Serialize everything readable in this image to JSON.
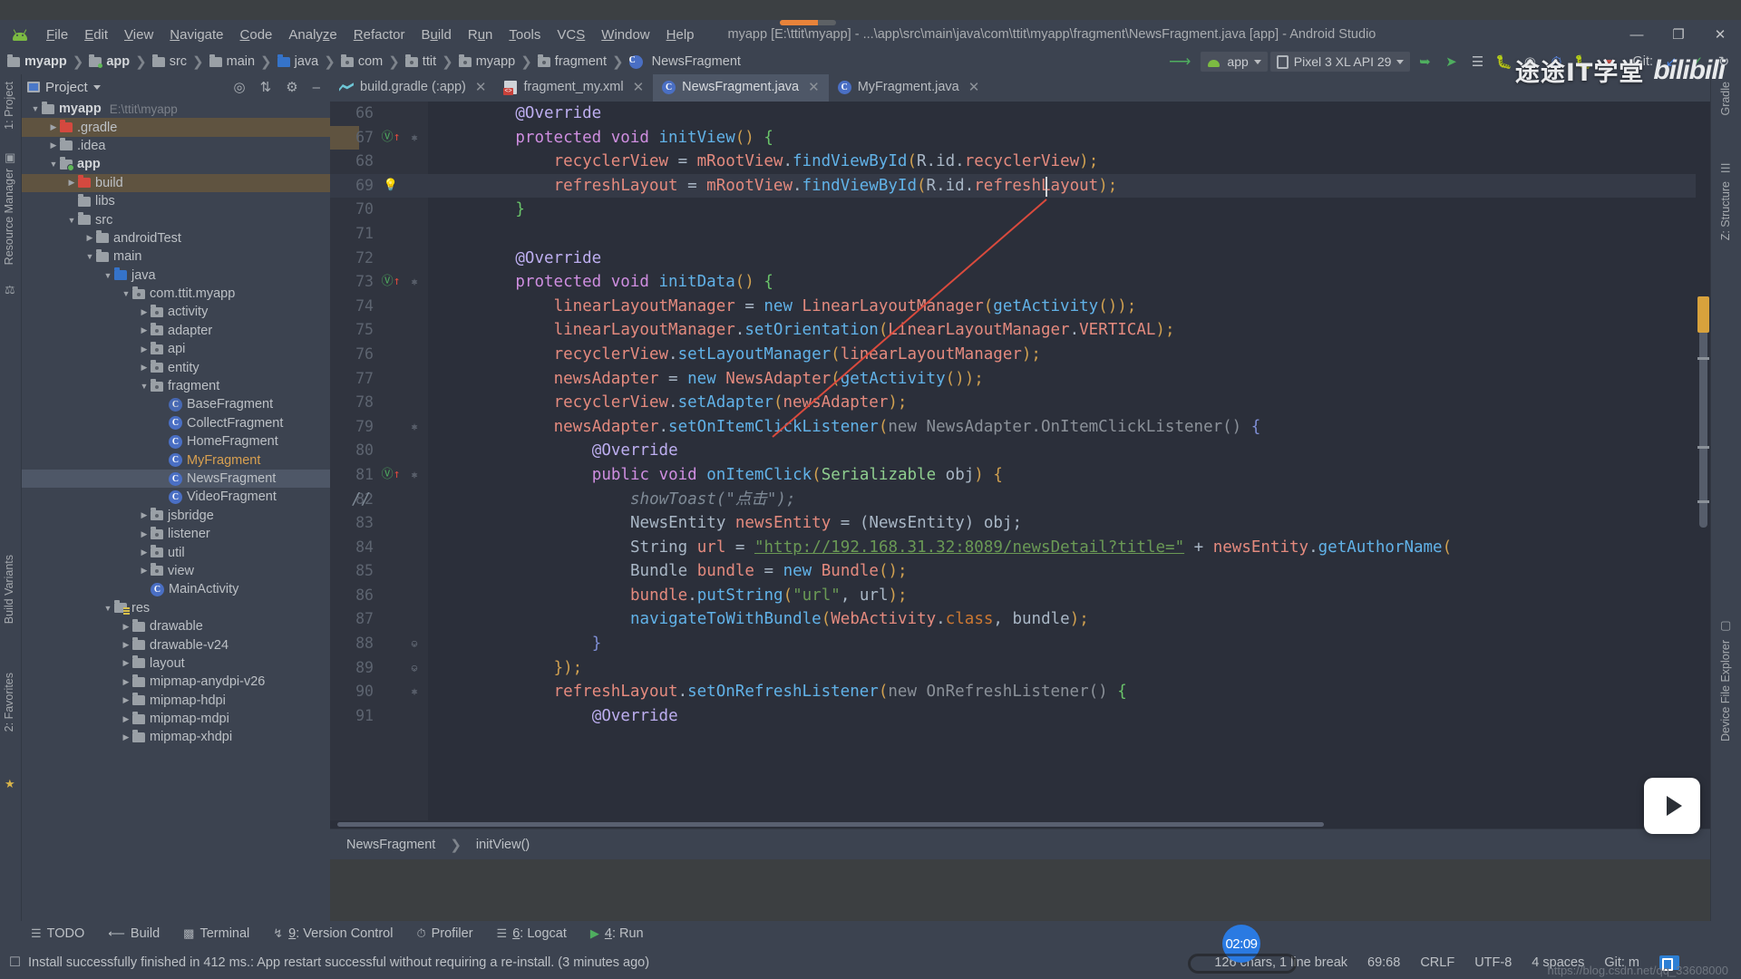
{
  "window": {
    "title": "myapp [E:\\ttit\\myapp] - ...\\app\\src\\main\\java\\com\\ttit\\myapp\\fragment\\NewsFragment.java [app] - Android Studio",
    "minimize": "—",
    "maximize": "❐",
    "close": "✕"
  },
  "menu": [
    "File",
    "Edit",
    "View",
    "Navigate",
    "Code",
    "Analyze",
    "Refactor",
    "Build",
    "Run",
    "Tools",
    "VCS",
    "Window",
    "Help"
  ],
  "breadcrumb": [
    {
      "label": "myapp",
      "icon": "folder-icon",
      "bold": true
    },
    {
      "label": "app",
      "icon": "module-folder-icon",
      "bold": true
    },
    {
      "label": "src",
      "icon": "folder-icon",
      "bold": false
    },
    {
      "label": "main",
      "icon": "folder-icon",
      "bold": false
    },
    {
      "label": "java",
      "icon": "source-folder-icon",
      "bold": false
    },
    {
      "label": "com",
      "icon": "package-icon",
      "bold": false
    },
    {
      "label": "ttit",
      "icon": "package-icon",
      "bold": false
    },
    {
      "label": "myapp",
      "icon": "package-icon",
      "bold": false
    },
    {
      "label": "fragment",
      "icon": "package-icon",
      "bold": false
    },
    {
      "label": "NewsFragment",
      "icon": "class-icon",
      "bold": false
    }
  ],
  "toolbar": {
    "run_config": "app",
    "device": "Pixel 3 XL API 29",
    "git_label": "Git:"
  },
  "watermark": {
    "chinese": "途途IT学堂",
    "brand": "bilibili"
  },
  "project_panel": {
    "title": "Project",
    "tree": [
      {
        "depth": 0,
        "tw": "▼",
        "icon": "folder",
        "label": "myapp",
        "bold": true,
        "path": "E:\\ttit\\myapp"
      },
      {
        "depth": 1,
        "tw": "▶",
        "icon": "folder-red",
        "label": ".gradle",
        "highlight": true
      },
      {
        "depth": 1,
        "tw": "▶",
        "icon": "folder",
        "label": ".idea"
      },
      {
        "depth": 1,
        "tw": "▼",
        "icon": "folder-module",
        "label": "app",
        "bold": true
      },
      {
        "depth": 2,
        "tw": "▶",
        "icon": "folder-red",
        "label": "build",
        "highlight": true
      },
      {
        "depth": 2,
        "tw": "",
        "icon": "folder",
        "label": "libs"
      },
      {
        "depth": 2,
        "tw": "▼",
        "icon": "folder",
        "label": "src"
      },
      {
        "depth": 3,
        "tw": "▶",
        "icon": "folder",
        "label": "androidTest"
      },
      {
        "depth": 3,
        "tw": "▼",
        "icon": "folder",
        "label": "main"
      },
      {
        "depth": 4,
        "tw": "▼",
        "icon": "folder-blue",
        "label": "java"
      },
      {
        "depth": 5,
        "tw": "▼",
        "icon": "package",
        "label": "com.ttit.myapp"
      },
      {
        "depth": 6,
        "tw": "▶",
        "icon": "package",
        "label": "activity"
      },
      {
        "depth": 6,
        "tw": "▶",
        "icon": "package",
        "label": "adapter"
      },
      {
        "depth": 6,
        "tw": "▶",
        "icon": "package",
        "label": "api"
      },
      {
        "depth": 6,
        "tw": "▶",
        "icon": "package",
        "label": "entity"
      },
      {
        "depth": 6,
        "tw": "▼",
        "icon": "package",
        "label": "fragment"
      },
      {
        "depth": 7,
        "tw": "",
        "icon": "class-abstract",
        "label": "BaseFragment"
      },
      {
        "depth": 7,
        "tw": "",
        "icon": "class",
        "label": "CollectFragment"
      },
      {
        "depth": 7,
        "tw": "",
        "icon": "class",
        "label": "HomeFragment"
      },
      {
        "depth": 7,
        "tw": "",
        "icon": "class",
        "label": "MyFragment",
        "orange": true
      },
      {
        "depth": 7,
        "tw": "",
        "icon": "class",
        "label": "NewsFragment",
        "selected": true
      },
      {
        "depth": 7,
        "tw": "",
        "icon": "class",
        "label": "VideoFragment"
      },
      {
        "depth": 6,
        "tw": "▶",
        "icon": "package",
        "label": "jsbridge"
      },
      {
        "depth": 6,
        "tw": "▶",
        "icon": "package",
        "label": "listener"
      },
      {
        "depth": 6,
        "tw": "▶",
        "icon": "package",
        "label": "util"
      },
      {
        "depth": 6,
        "tw": "▶",
        "icon": "package",
        "label": "view"
      },
      {
        "depth": 6,
        "tw": "",
        "icon": "class",
        "label": "MainActivity"
      },
      {
        "depth": 4,
        "tw": "▼",
        "icon": "folder-res",
        "label": "res"
      },
      {
        "depth": 5,
        "tw": "▶",
        "icon": "folder",
        "label": "drawable"
      },
      {
        "depth": 5,
        "tw": "▶",
        "icon": "folder",
        "label": "drawable-v24"
      },
      {
        "depth": 5,
        "tw": "▶",
        "icon": "folder",
        "label": "layout"
      },
      {
        "depth": 5,
        "tw": "▶",
        "icon": "folder",
        "label": "mipmap-anydpi-v26"
      },
      {
        "depth": 5,
        "tw": "▶",
        "icon": "folder",
        "label": "mipmap-hdpi"
      },
      {
        "depth": 5,
        "tw": "▶",
        "icon": "folder",
        "label": "mipmap-mdpi"
      },
      {
        "depth": 5,
        "tw": "▶",
        "icon": "folder",
        "label": "mipmap-xhdpi"
      }
    ]
  },
  "left_strip": [
    "1: Project",
    "Resource Manager",
    "Build Variants",
    "2: Favorites"
  ],
  "right_strip": [
    "Gradle",
    "Z: Structure",
    "Device File Explorer"
  ],
  "editor": {
    "tabs": [
      {
        "label": "build.gradle (:app)",
        "icon": "gradle-icon",
        "active": false
      },
      {
        "label": "fragment_my.xml",
        "icon": "xml-icon",
        "active": false
      },
      {
        "label": "NewsFragment.java",
        "icon": "class-icon",
        "active": true
      },
      {
        "label": "MyFragment.java",
        "icon": "class-icon",
        "active": false
      }
    ],
    "breadcrumb_bottom": [
      "NewsFragment",
      "initView()"
    ],
    "first_line": 66,
    "lines": [
      {
        "n": 66,
        "indent": 8,
        "tokens": [
          {
            "t": "@Override",
            "c": "anno"
          }
        ]
      },
      {
        "n": 67,
        "indent": 8,
        "mark": "override",
        "fold": "minus",
        "tokens": [
          {
            "t": "protected ",
            "c": "kw2"
          },
          {
            "t": "void ",
            "c": "kw2"
          },
          {
            "t": "initView",
            "c": "mth"
          },
          {
            "t": "()",
            "c": "par"
          },
          {
            "t": " {",
            "c": "brace-g"
          }
        ]
      },
      {
        "n": 68,
        "indent": 12,
        "tokens": [
          {
            "t": "recyclerView",
            "c": "fld"
          },
          {
            "t": " = ",
            "c": "pnc"
          },
          {
            "t": "mRootView",
            "c": "fld"
          },
          {
            "t": ".",
            "c": "pnc"
          },
          {
            "t": "findViewById",
            "c": "mth"
          },
          {
            "t": "(",
            "c": "par"
          },
          {
            "t": "R",
            "c": "typ"
          },
          {
            "t": ".",
            "c": "pnc"
          },
          {
            "t": "id",
            "c": "typ"
          },
          {
            "t": ".",
            "c": "pnc"
          },
          {
            "t": "recyclerView",
            "c": "fld"
          },
          {
            "t": ");",
            "c": "par"
          }
        ]
      },
      {
        "n": 69,
        "indent": 12,
        "mark": "bulb",
        "current": true,
        "tokens": [
          {
            "t": "refreshLayout",
            "c": "fld"
          },
          {
            "t": " = ",
            "c": "pnc"
          },
          {
            "t": "mRootView",
            "c": "fld"
          },
          {
            "t": ".",
            "c": "pnc"
          },
          {
            "t": "findViewById",
            "c": "mth"
          },
          {
            "t": "(",
            "c": "par"
          },
          {
            "t": "R",
            "c": "typ"
          },
          {
            "t": ".",
            "c": "pnc"
          },
          {
            "t": "id",
            "c": "typ"
          },
          {
            "t": ".",
            "c": "pnc"
          },
          {
            "t": "refreshLayout",
            "c": "fld"
          },
          {
            "t": ");",
            "c": "par"
          }
        ]
      },
      {
        "n": 70,
        "indent": 8,
        "tokens": [
          {
            "t": "}",
            "c": "brace-g"
          }
        ]
      },
      {
        "n": 71,
        "indent": 0,
        "tokens": []
      },
      {
        "n": 72,
        "indent": 8,
        "tokens": [
          {
            "t": "@Override",
            "c": "anno"
          }
        ]
      },
      {
        "n": 73,
        "indent": 8,
        "mark": "override",
        "fold": "minus",
        "tokens": [
          {
            "t": "protected ",
            "c": "kw2"
          },
          {
            "t": "void ",
            "c": "kw2"
          },
          {
            "t": "initData",
            "c": "mth"
          },
          {
            "t": "()",
            "c": "par"
          },
          {
            "t": " {",
            "c": "brace-g"
          }
        ]
      },
      {
        "n": 74,
        "indent": 12,
        "tokens": [
          {
            "t": "linearLayoutManager",
            "c": "fld"
          },
          {
            "t": " = ",
            "c": "pnc"
          },
          {
            "t": "new ",
            "c": "mth"
          },
          {
            "t": "LinearLayoutManager",
            "c": "fld"
          },
          {
            "t": "(",
            "c": "par"
          },
          {
            "t": "getActivity",
            "c": "mth"
          },
          {
            "t": "());",
            "c": "par"
          }
        ]
      },
      {
        "n": 75,
        "indent": 12,
        "tokens": [
          {
            "t": "linearLayoutManager",
            "c": "fld"
          },
          {
            "t": ".",
            "c": "pnc"
          },
          {
            "t": "setOrientation",
            "c": "mth"
          },
          {
            "t": "(",
            "c": "par"
          },
          {
            "t": "LinearLayoutManager",
            "c": "fld"
          },
          {
            "t": ".",
            "c": "pnc"
          },
          {
            "t": "VERTICAL",
            "c": "fld"
          },
          {
            "t": ");",
            "c": "par"
          }
        ]
      },
      {
        "n": 76,
        "indent": 12,
        "tokens": [
          {
            "t": "recyclerView",
            "c": "fld"
          },
          {
            "t": ".",
            "c": "pnc"
          },
          {
            "t": "setLayoutManager",
            "c": "mth"
          },
          {
            "t": "(",
            "c": "par"
          },
          {
            "t": "linearLayoutManager",
            "c": "fld"
          },
          {
            "t": ");",
            "c": "par"
          }
        ]
      },
      {
        "n": 77,
        "indent": 12,
        "tokens": [
          {
            "t": "newsAdapter",
            "c": "fld"
          },
          {
            "t": " = ",
            "c": "pnc"
          },
          {
            "t": "new ",
            "c": "mth"
          },
          {
            "t": "NewsAdapter",
            "c": "fld"
          },
          {
            "t": "(",
            "c": "par"
          },
          {
            "t": "getActivity",
            "c": "mth"
          },
          {
            "t": "());",
            "c": "par"
          }
        ]
      },
      {
        "n": 78,
        "indent": 12,
        "tokens": [
          {
            "t": "recyclerView",
            "c": "fld"
          },
          {
            "t": ".",
            "c": "pnc"
          },
          {
            "t": "setAdapter",
            "c": "mth"
          },
          {
            "t": "(",
            "c": "par"
          },
          {
            "t": "newsAdapter",
            "c": "fld"
          },
          {
            "t": ");",
            "c": "par"
          }
        ]
      },
      {
        "n": 79,
        "indent": 12,
        "fold": "minus",
        "tokens": [
          {
            "t": "newsAdapter",
            "c": "fld"
          },
          {
            "t": ".",
            "c": "pnc"
          },
          {
            "t": "setOnItemClickListener",
            "c": "mth"
          },
          {
            "t": "(",
            "c": "par"
          },
          {
            "t": "new NewsAdapter.OnItemClickListener() ",
            "c": "grey"
          },
          {
            "t": "{",
            "c": "brace-p"
          }
        ]
      },
      {
        "n": 80,
        "indent": 16,
        "tokens": [
          {
            "t": "@Override",
            "c": "anno"
          }
        ]
      },
      {
        "n": 81,
        "indent": 16,
        "mark": "override",
        "fold": "minus",
        "tokens": [
          {
            "t": "public ",
            "c": "kw2"
          },
          {
            "t": "void ",
            "c": "kw2"
          },
          {
            "t": "onItemClick",
            "c": "mth"
          },
          {
            "t": "(",
            "c": "par"
          },
          {
            "t": "Serializable",
            "c": "cls"
          },
          {
            "t": " obj",
            "c": "typ"
          },
          {
            "t": ") {",
            "c": "par"
          }
        ]
      },
      {
        "n": 82,
        "indent": 20,
        "comment_slashes": true,
        "tokens": [
          {
            "t": "showToast(\"点击\");",
            "c": "cmt"
          }
        ]
      },
      {
        "n": 83,
        "indent": 20,
        "tokens": [
          {
            "t": "NewsEntity",
            "c": "typ"
          },
          {
            "t": " newsEntity",
            "c": "fld"
          },
          {
            "t": " = (",
            "c": "pnc"
          },
          {
            "t": "NewsEntity",
            "c": "typ"
          },
          {
            "t": ") obj;",
            "c": "pnc"
          }
        ]
      },
      {
        "n": 84,
        "indent": 20,
        "tokens": [
          {
            "t": "String",
            "c": "typ"
          },
          {
            "t": " url",
            "c": "fld"
          },
          {
            "t": " = ",
            "c": "pnc"
          },
          {
            "t": "\"http://192.168.31.32:8089/newsDetail?title=\"",
            "c": "url"
          },
          {
            "t": " + ",
            "c": "pnc"
          },
          {
            "t": "newsEntity",
            "c": "fld"
          },
          {
            "t": ".",
            "c": "pnc"
          },
          {
            "t": "getAuthorName",
            "c": "mth"
          },
          {
            "t": "(",
            "c": "par"
          }
        ]
      },
      {
        "n": 85,
        "indent": 20,
        "tokens": [
          {
            "t": "Bundle",
            "c": "typ"
          },
          {
            "t": " bundle",
            "c": "fld"
          },
          {
            "t": " = ",
            "c": "pnc"
          },
          {
            "t": "new ",
            "c": "mth"
          },
          {
            "t": "Bundle",
            "c": "fld"
          },
          {
            "t": "();",
            "c": "par"
          }
        ]
      },
      {
        "n": 86,
        "indent": 20,
        "tokens": [
          {
            "t": "bundle",
            "c": "fld"
          },
          {
            "t": ".",
            "c": "pnc"
          },
          {
            "t": "putString",
            "c": "mth"
          },
          {
            "t": "(",
            "c": "par"
          },
          {
            "t": "\"url\"",
            "c": "str"
          },
          {
            "t": ", url",
            "c": "pnc"
          },
          {
            "t": ");",
            "c": "par"
          }
        ]
      },
      {
        "n": 87,
        "indent": 20,
        "tokens": [
          {
            "t": "navigateToWithBundle",
            "c": "mth"
          },
          {
            "t": "(",
            "c": "par"
          },
          {
            "t": "WebActivity",
            "c": "fld"
          },
          {
            "t": ".",
            "c": "pnc"
          },
          {
            "t": "class",
            "c": "kw"
          },
          {
            "t": ", bundle",
            "c": "pnc"
          },
          {
            "t": ");",
            "c": "par"
          }
        ]
      },
      {
        "n": 88,
        "indent": 16,
        "fold": "end",
        "tokens": [
          {
            "t": "}",
            "c": "brace-p"
          }
        ]
      },
      {
        "n": 89,
        "indent": 12,
        "fold": "end",
        "tokens": [
          {
            "t": "});",
            "c": "par"
          }
        ]
      },
      {
        "n": 90,
        "indent": 12,
        "fold": "minus",
        "tokens": [
          {
            "t": "refreshLayout",
            "c": "fld"
          },
          {
            "t": ".",
            "c": "pnc"
          },
          {
            "t": "setOnRefreshListener",
            "c": "mth"
          },
          {
            "t": "(",
            "c": "par"
          },
          {
            "t": "new OnRefreshListener() ",
            "c": "grey"
          },
          {
            "t": "{",
            "c": "brace-g"
          }
        ]
      },
      {
        "n": 91,
        "indent": 16,
        "tokens": [
          {
            "t": "@Override",
            "c": "anno"
          }
        ]
      }
    ]
  },
  "tool_windows": [
    {
      "label": "TODO",
      "icon": "list-icon"
    },
    {
      "label": "Build",
      "icon": "hammer-icon"
    },
    {
      "label": "Terminal",
      "icon": "terminal-icon"
    },
    {
      "label": "9: Version Control",
      "icon": "branch-icon",
      "underline": "9"
    },
    {
      "label": "Profiler",
      "icon": "gauge-icon"
    },
    {
      "label": "6: Logcat",
      "icon": "logcat-icon",
      "underline": "6"
    },
    {
      "label": "4: Run",
      "icon": "run-icon",
      "underline": "4"
    }
  ],
  "status_bar": {
    "message": "Install successfully finished in 412 ms.: App restart successful without requiring a re-install. (3 minutes ago)",
    "chars": "126 chars, 1 line break",
    "caret": "69:68",
    "line_sep": "CRLF",
    "encoding": "UTF-8",
    "indent": "4 spaces",
    "git_branch": "Git: m",
    "clock": "02:09",
    "source_url": "https://blog.csdn.net/qq_33608000"
  }
}
